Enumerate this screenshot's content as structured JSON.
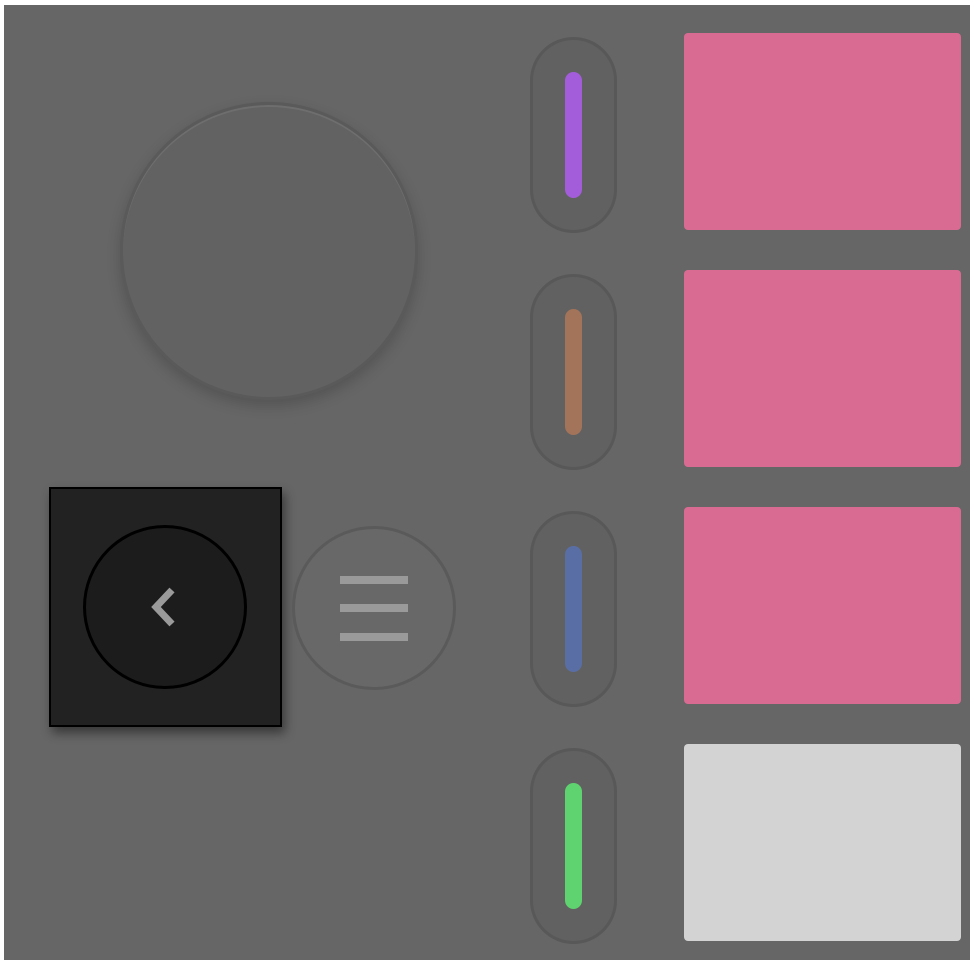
{
  "controls": {
    "knob": {
      "icon": "rotary-knob"
    },
    "back_button": {
      "icon": "chevron-left-icon"
    },
    "menu_button": {
      "icon": "menu-icon"
    }
  },
  "sliders": [
    {
      "color": "#a35ddb"
    },
    {
      "color": "#a3745a"
    },
    {
      "color": "#5a6ea6"
    },
    {
      "color": "#5ed36f"
    }
  ],
  "pads": [
    {
      "color": "#d96b93"
    },
    {
      "color": "#d96b93"
    },
    {
      "color": "#d96b93"
    },
    {
      "color": "#d3d3d3"
    }
  ],
  "colors": {
    "panel": "#666666",
    "back_frame": "#222222"
  }
}
